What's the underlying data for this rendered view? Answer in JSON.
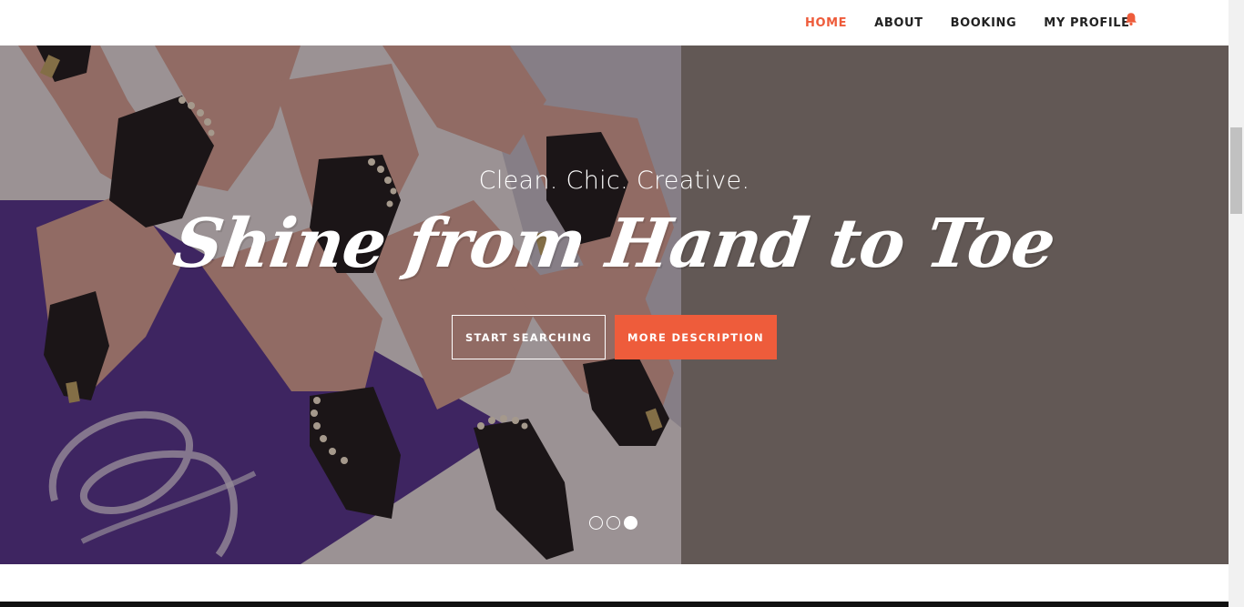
{
  "nav": {
    "items": [
      {
        "label": "HOME",
        "active": true
      },
      {
        "label": "ABOUT",
        "active": false
      },
      {
        "label": "BOOKING",
        "active": false
      },
      {
        "label": "MY PROFILE",
        "active": false
      }
    ],
    "notification_icon": "bell-icon"
  },
  "hero": {
    "tagline": "Clean. Chic. Creative.",
    "headline": "Shine from Hand to Toe",
    "primary_button": "START SEARCHING",
    "secondary_button": "MORE DESCRIPTION",
    "slides": {
      "count": 3,
      "active_index": 2
    },
    "image": "nail-art-photo"
  },
  "colors": {
    "accent": "#ee5c3b",
    "hero_background": "#625855",
    "nav_text": "#222222"
  }
}
